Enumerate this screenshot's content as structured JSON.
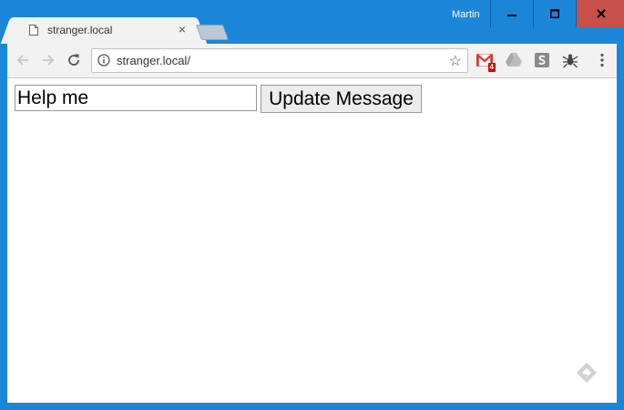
{
  "window": {
    "user_name": "Martin"
  },
  "tab": {
    "title": "stranger.local",
    "close_glyph": "×"
  },
  "toolbar": {
    "url": "stranger.local/",
    "star_glyph": "☆",
    "gmail_badge": "4",
    "menu_glyph": "⋮"
  },
  "page": {
    "input_value": "Help me",
    "button_label": "Update Message"
  },
  "colors": {
    "frame": "#1c86d8",
    "close_button": "#c7504a",
    "toolbar": "#f2f2f2"
  }
}
